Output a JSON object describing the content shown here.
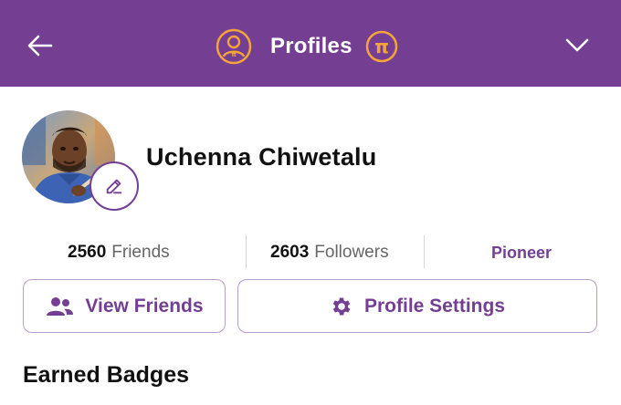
{
  "header": {
    "title": "Profiles",
    "back_icon": "arrow-left-icon",
    "user_icon": "user-circle-icon",
    "pi_icon": "pi-coin-icon",
    "chevron_icon": "chevron-down-icon"
  },
  "profile": {
    "name": "Uchenna Chiwetalu",
    "edit_icon": "pencil-icon"
  },
  "stats": {
    "friends_count": "2560",
    "friends_label": "Friends",
    "followers_count": "2603",
    "followers_label": "Followers",
    "role": "Pioneer"
  },
  "actions": {
    "view_friends_label": "View Friends",
    "view_friends_icon": "people-icon",
    "profile_settings_label": "Profile Settings",
    "profile_settings_icon": "gear-icon"
  },
  "sections": {
    "badges_title": "Earned Badges"
  },
  "colors": {
    "brand": "#743f93",
    "accent": "#f4a43a",
    "border": "#b79ec8"
  }
}
